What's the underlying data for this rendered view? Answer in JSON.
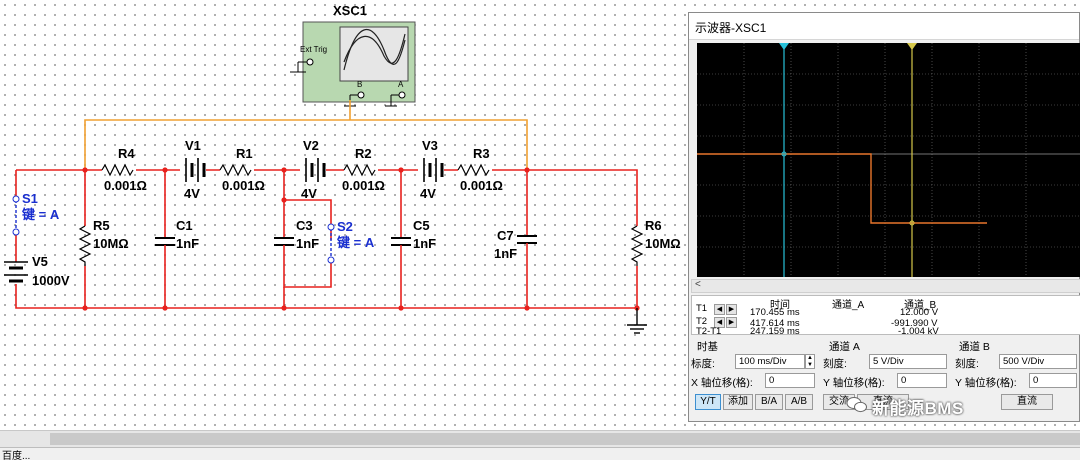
{
  "circuit": {
    "scope": {
      "name": "XSC1",
      "ext_trig": "Ext Trig",
      "ch_a": "A",
      "ch_b": "B"
    },
    "resistors": [
      {
        "id": "R4",
        "value": "0.001Ω"
      },
      {
        "id": "R1",
        "value": "0.001Ω"
      },
      {
        "id": "R2",
        "value": "0.001Ω"
      },
      {
        "id": "R3",
        "value": "0.001Ω"
      },
      {
        "id": "R5",
        "value": "10MΩ"
      },
      {
        "id": "R6",
        "value": "10MΩ"
      }
    ],
    "batteries": [
      {
        "id": "V1",
        "value": "4V"
      },
      {
        "id": "V2",
        "value": "4V"
      },
      {
        "id": "V3",
        "value": "4V"
      },
      {
        "id": "V5",
        "value": "1000V"
      }
    ],
    "capacitors": [
      {
        "id": "C1",
        "value": "1nF"
      },
      {
        "id": "C3",
        "value": "1nF"
      },
      {
        "id": "C5",
        "value": "1nF"
      },
      {
        "id": "C7",
        "value": "1nF"
      }
    ],
    "switches": [
      {
        "id": "S1",
        "key": "键 = A"
      },
      {
        "id": "S2",
        "key": "键 = A"
      }
    ],
    "colors": {
      "wire_red": "#e8211d",
      "wire_orange": "#f0a030",
      "trace_orange": "#e8762c",
      "cursor1": "#27c0d8",
      "cursor2": "#d6c84a"
    }
  },
  "oscilloscope": {
    "title": "示波器-XSC1",
    "measurements": {
      "headers": {
        "time": "时间",
        "ch_a": "通道_A",
        "ch_b": "通道_B"
      },
      "rows": [
        {
          "label": "T1",
          "time": "170.455 ms",
          "ch_b": "12.000 V"
        },
        {
          "label": "T2",
          "time": "417.614 ms",
          "ch_b": "-991.990 V"
        },
        {
          "label": "T2-T1",
          "time": "247.159 ms",
          "ch_b": "-1.004 kV"
        }
      ]
    },
    "timebase": {
      "title": "时基",
      "scale_label": "标度:",
      "scale_value": "100 ms/Div",
      "xpos_label": "X 轴位移(格):",
      "xpos_value": "0"
    },
    "channel_a": {
      "title": "通道 A",
      "scale_label": "刻度:",
      "scale_value": "5  V/Div",
      "ypos_label": "Y 轴位移(格):",
      "ypos_value": "0",
      "ac": "交流",
      "dc": "直流"
    },
    "channel_b": {
      "title": "通道 B",
      "scale_label": "刻度:",
      "scale_value": "500  V/Div",
      "ypos_label": "Y 轴位移(格):",
      "ypos_value": "0",
      "dc": "直流"
    },
    "mode_buttons": {
      "yt": "Y/T",
      "add": "添加",
      "ba": "B/A",
      "ab": "A/B"
    }
  },
  "watermark": "新能源BMS",
  "statusbar": "百度..."
}
